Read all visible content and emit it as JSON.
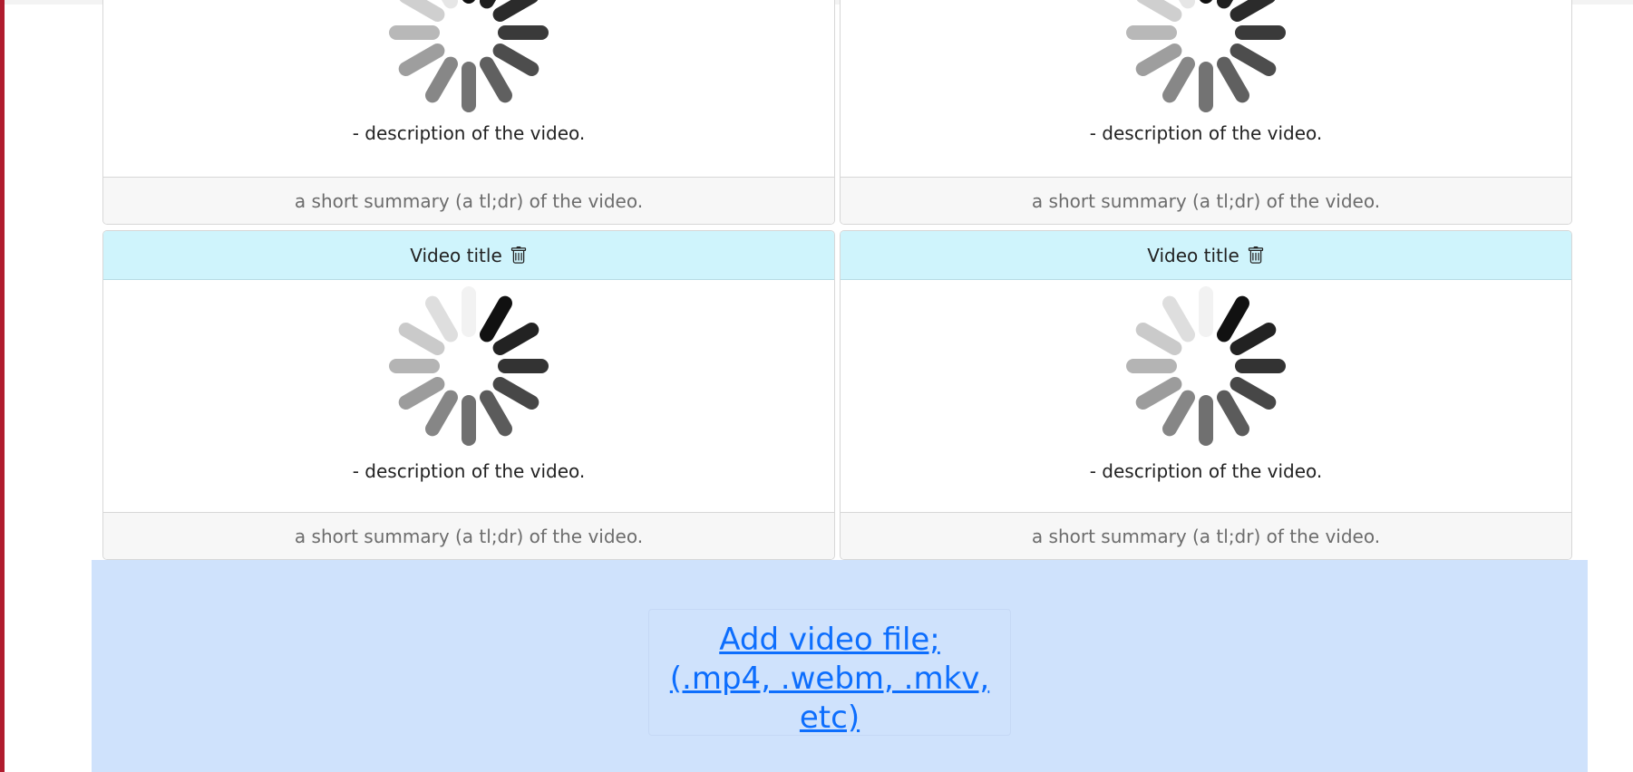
{
  "cards": [
    {
      "title": "",
      "description": "- description of the video.",
      "summary": "a short summary (a tl;dr) of the video."
    },
    {
      "title": "",
      "description": "- description of the video.",
      "summary": "a short summary (a tl;dr) of the video."
    },
    {
      "title": "Video title",
      "description": "- description of the video.",
      "summary": "a short summary (a tl;dr) of the video."
    },
    {
      "title": "Video title",
      "description": "- description of the video.",
      "summary": "a short summary (a tl;dr) of the video."
    }
  ],
  "upload": {
    "line1": "Add video file;",
    "line2": "(.mp4, .webm, .mkv, etc)"
  },
  "colors": {
    "header_bg": "#cff4fc",
    "upload_bg": "#cfe2fc",
    "link": "#0d6efd",
    "left_edge": "#b01c2e"
  },
  "icons": {
    "delete": "trash-icon",
    "upload": "cloud-upload-icon",
    "loading": "loading-spinner-icon"
  }
}
